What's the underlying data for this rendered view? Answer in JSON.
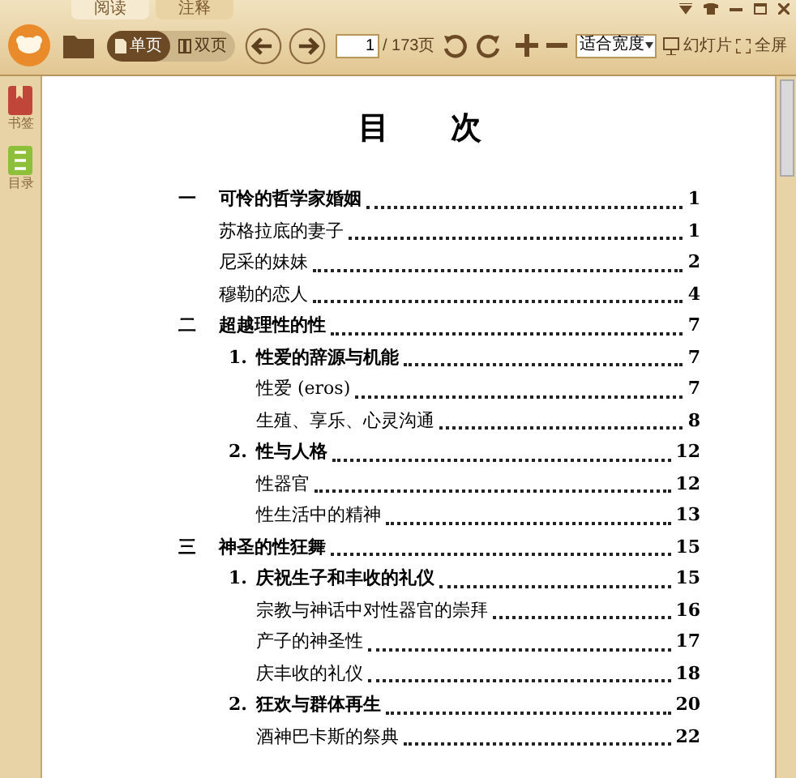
{
  "tabs": [
    {
      "label": "阅读",
      "selected": true
    },
    {
      "label": "注释",
      "selected": false
    }
  ],
  "toolbar": {
    "view_modes": [
      {
        "label": "单页",
        "selected": true
      },
      {
        "label": "双页",
        "selected": false
      }
    ],
    "page_input": "1",
    "page_total": "/ 173页",
    "zoom_select": "适合宽度",
    "slideshow": "幻灯片",
    "fullscreen": "全屏"
  },
  "sidebar": {
    "items": [
      {
        "label": "书签",
        "kind": "bookmark"
      },
      {
        "label": "目录",
        "kind": "contents"
      }
    ]
  },
  "document": {
    "title": "目　　次",
    "chapters": [
      {
        "number": "一",
        "title": "可怜的哲学家婚姻",
        "page": "1",
        "children": [
          {
            "title": "苏格拉底的妻子",
            "page": "1"
          },
          {
            "title": "尼采的妹妹",
            "page": "2"
          },
          {
            "title": "穆勒的恋人",
            "page": "4"
          }
        ]
      },
      {
        "number": "二",
        "title": "超越理性的性",
        "page": "7",
        "children": [
          {
            "number": "1.",
            "title": "性爱的辞源与机能",
            "page": "7",
            "children": [
              {
                "title": "性爱 (eros)",
                "page": "7"
              },
              {
                "title": "生殖、享乐、心灵沟通",
                "page": "8"
              }
            ]
          },
          {
            "number": "2.",
            "title": "性与人格",
            "page": "12",
            "children": [
              {
                "title": "性器官",
                "page": "12"
              },
              {
                "title": "性生活中的精神",
                "page": "13"
              }
            ]
          }
        ]
      },
      {
        "number": "三",
        "title": "神圣的性狂舞",
        "page": "15",
        "children": [
          {
            "number": "1.",
            "title": "庆祝生子和丰收的礼仪",
            "page": "15",
            "children": [
              {
                "title": "宗教与神话中对性器官的崇拜",
                "page": "16"
              },
              {
                "title": "产子的神圣性",
                "page": "17"
              },
              {
                "title": "庆丰收的礼仪",
                "page": "18"
              }
            ]
          },
          {
            "number": "2.",
            "title": "狂欢与群体再生",
            "page": "20",
            "children": [
              {
                "title": "酒神巴卡斯的祭典",
                "page": "22"
              }
            ]
          }
        ]
      }
    ]
  }
}
